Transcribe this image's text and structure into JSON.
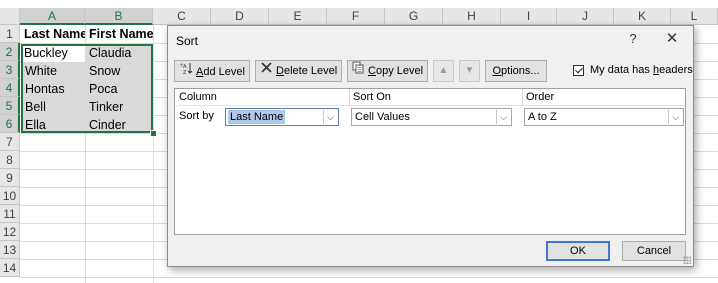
{
  "sheet": {
    "columns": [
      "A",
      "B",
      "C",
      "D",
      "E",
      "F",
      "G",
      "H",
      "I",
      "J",
      "K",
      "L"
    ],
    "rows": [
      "1",
      "2",
      "3",
      "4",
      "5",
      "6",
      "7",
      "8",
      "9",
      "10",
      "11",
      "12",
      "13",
      "14"
    ],
    "cells": {
      "A1": "Last Name",
      "B1": "First Name",
      "A2": "Buckley",
      "B2": "Claudia",
      "A3": "White",
      "B3": "Snow",
      "A4": "Hontas",
      "B4": "Poca",
      "A5": "Bell",
      "B5": "Tinker",
      "A6": "Ella",
      "B6": "Cinder"
    },
    "selection_color": "#217346"
  },
  "dialog": {
    "title": "Sort",
    "help": "?",
    "close": "✕",
    "toolbar": {
      "add_level": {
        "pre": "",
        "ul": "A",
        "post": "dd Level"
      },
      "delete_level": {
        "pre": "",
        "ul": "D",
        "post": "elete Level"
      },
      "copy_level": {
        "pre": "",
        "ul": "C",
        "post": "opy Level"
      },
      "move_up": "▲",
      "move_down": "▼",
      "options": {
        "pre": "",
        "ul": "O",
        "post": "ptions..."
      }
    },
    "my_data_headers": {
      "pre": "My data has ",
      "ul": "h",
      "post": "eaders",
      "checked": true
    },
    "columns": {
      "column": "Column",
      "sort_on": "Sort On",
      "order": "Order"
    },
    "level": {
      "label": "Sort by",
      "column_value": "Last Name",
      "sort_on_value": "Cell Values",
      "order_value": "A to Z"
    },
    "ok": "OK",
    "cancel": "Cancel"
  }
}
